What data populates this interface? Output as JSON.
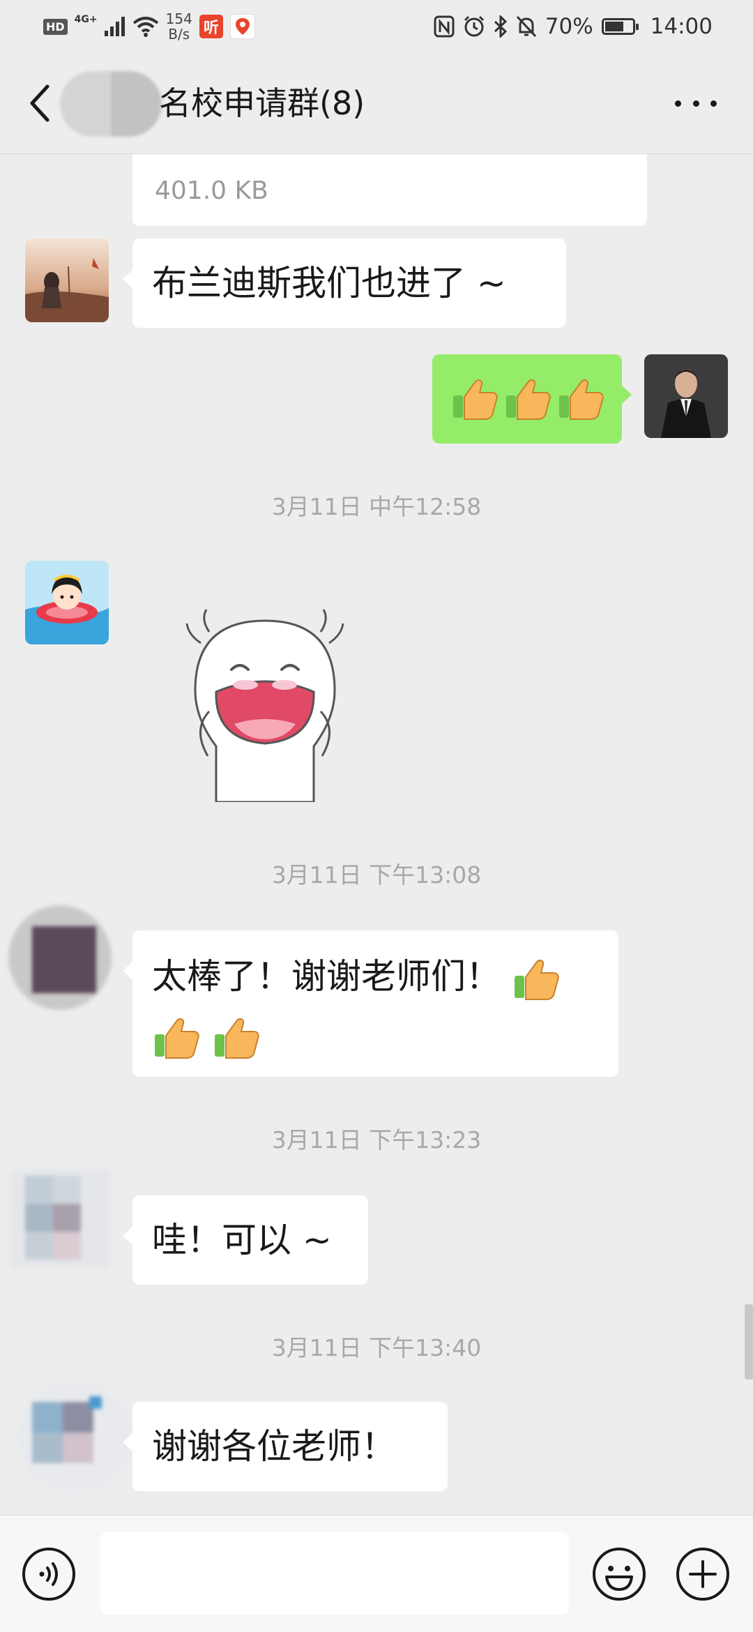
{
  "status_bar": {
    "hd": "HD",
    "network": "4G+",
    "speed_value": "154",
    "speed_unit": "B/s",
    "app_icon_text": "听",
    "battery": "70%",
    "battery_level": 0.7,
    "time": "14:00"
  },
  "header": {
    "title": "名校申请群(8)"
  },
  "messages": {
    "file": {
      "size": "401.0 KB"
    },
    "msg1": {
      "text": "布兰迪斯我们也进了 ~"
    },
    "time1": "3月11日 中午12:58",
    "time2": "3月11日 下午13:08",
    "msg3": {
      "text": "太棒了！谢谢老师们！"
    },
    "time3": "3月11日 下午13:23",
    "msg4": {
      "text": "哇！可以 ~"
    },
    "time4": "3月11日 下午13:40",
    "msg5": {
      "text": "谢谢各位老师！"
    }
  },
  "input": {
    "placeholder": ""
  },
  "colors": {
    "background": "#ededed",
    "self_bubble": "#95ec69",
    "other_bubble": "#ffffff",
    "timestamp": "#a8a8a8"
  },
  "icons": [
    "back-arrow-icon",
    "more-icon",
    "voice-icon",
    "emoji-icon",
    "plus-icon",
    "thumbs-up-icon"
  ]
}
